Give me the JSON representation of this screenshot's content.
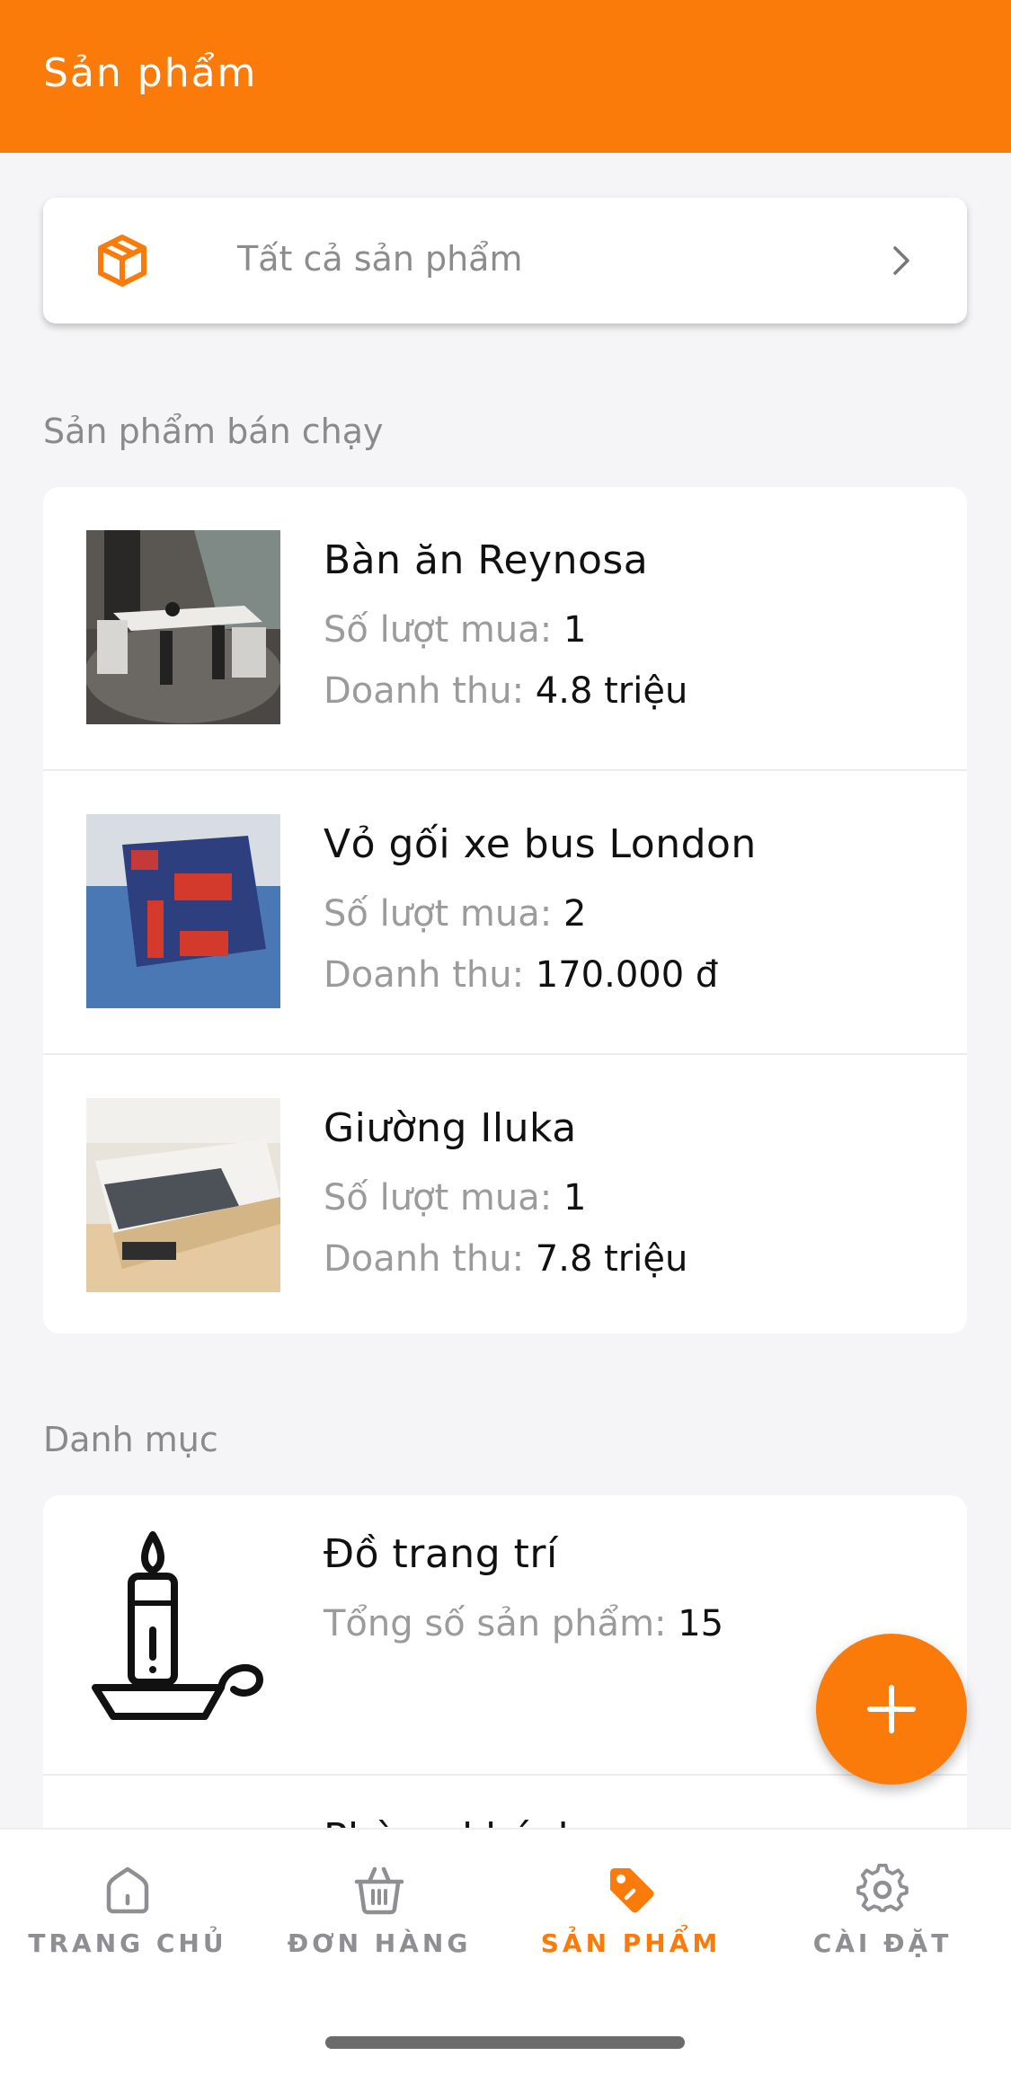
{
  "header": {
    "title": "Sản phẩm"
  },
  "all_products": {
    "label": "Tất cả sản phẩm",
    "icon": "box-icon"
  },
  "bestsellers": {
    "title": "Sản phẩm bán chạy",
    "purchases_label": "Số lượt mua: ",
    "revenue_label": "Doanh thu: ",
    "items": [
      {
        "name": "Bàn ăn Reynosa",
        "purchases": "1",
        "revenue": "4.8 triệu"
      },
      {
        "name": "Vỏ gối xe bus London",
        "purchases": "2",
        "revenue": "170.000 đ"
      },
      {
        "name": "Giường Iluka",
        "purchases": "1",
        "revenue": "7.8 triệu"
      }
    ]
  },
  "categories": {
    "title": "Danh mục",
    "total_label": "Tổng số sản phẩm: ",
    "items": [
      {
        "name": "Đồ trang trí",
        "total": "15"
      },
      {
        "name": "Phòng khách"
      }
    ]
  },
  "fab": {
    "icon": "plus-icon"
  },
  "tabbar": {
    "tabs": [
      {
        "label": "TRANG CHỦ",
        "icon": "home-icon",
        "active": false
      },
      {
        "label": "ĐƠN HÀNG",
        "icon": "basket-icon",
        "active": false
      },
      {
        "label": "SẢN PHẨM",
        "icon": "tag-icon",
        "active": true
      },
      {
        "label": "CÀI ĐẶT",
        "icon": "gear-icon",
        "active": false
      }
    ]
  },
  "colors": {
    "accent": "#fb7b0a",
    "muted": "#9b9b9b",
    "background": "#f5f5f7"
  }
}
